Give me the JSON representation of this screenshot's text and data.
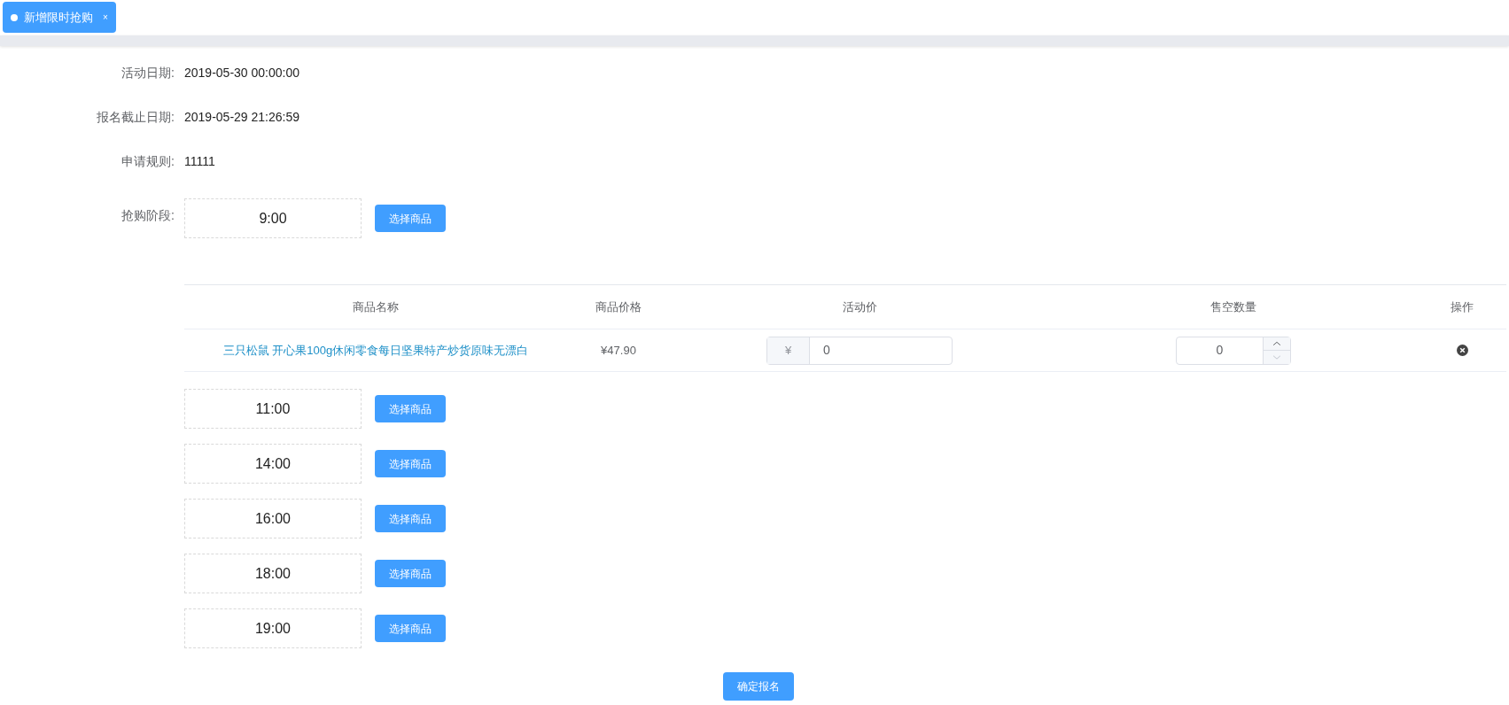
{
  "tabs": [
    {
      "label": "新增限时抢购",
      "selected": true,
      "close": "×"
    }
  ],
  "fields": [
    {
      "label": "活动日期:",
      "value": "2019-05-30 00:00:00"
    },
    {
      "label": "报名截止日期:",
      "value": "2019-05-29 21:26:59"
    },
    {
      "label": "申请规则:",
      "value": "11111"
    }
  ],
  "stages_label": "抢购阶段:",
  "stages": [
    {
      "time": "9:00",
      "button": "选择商品",
      "table": {
        "columns": [
          "商品名称",
          "商品价格",
          "活动价",
          "售空数量",
          "操作"
        ],
        "rows": [
          {
            "name": "三只松鼠 开心果100g休闲零食每日坚果特产炒货原味无漂白",
            "price": "¥47.90",
            "currency": "¥",
            "activity_price": "0",
            "sold_out_qty": "0"
          }
        ]
      }
    },
    {
      "time": "11:00",
      "button": "选择商品"
    },
    {
      "time": "14:00",
      "button": "选择商品"
    },
    {
      "time": "16:00",
      "button": "选择商品"
    },
    {
      "time": "18:00",
      "button": "选择商品"
    },
    {
      "time": "19:00",
      "button": "选择商品"
    }
  ],
  "submit": "确定报名"
}
